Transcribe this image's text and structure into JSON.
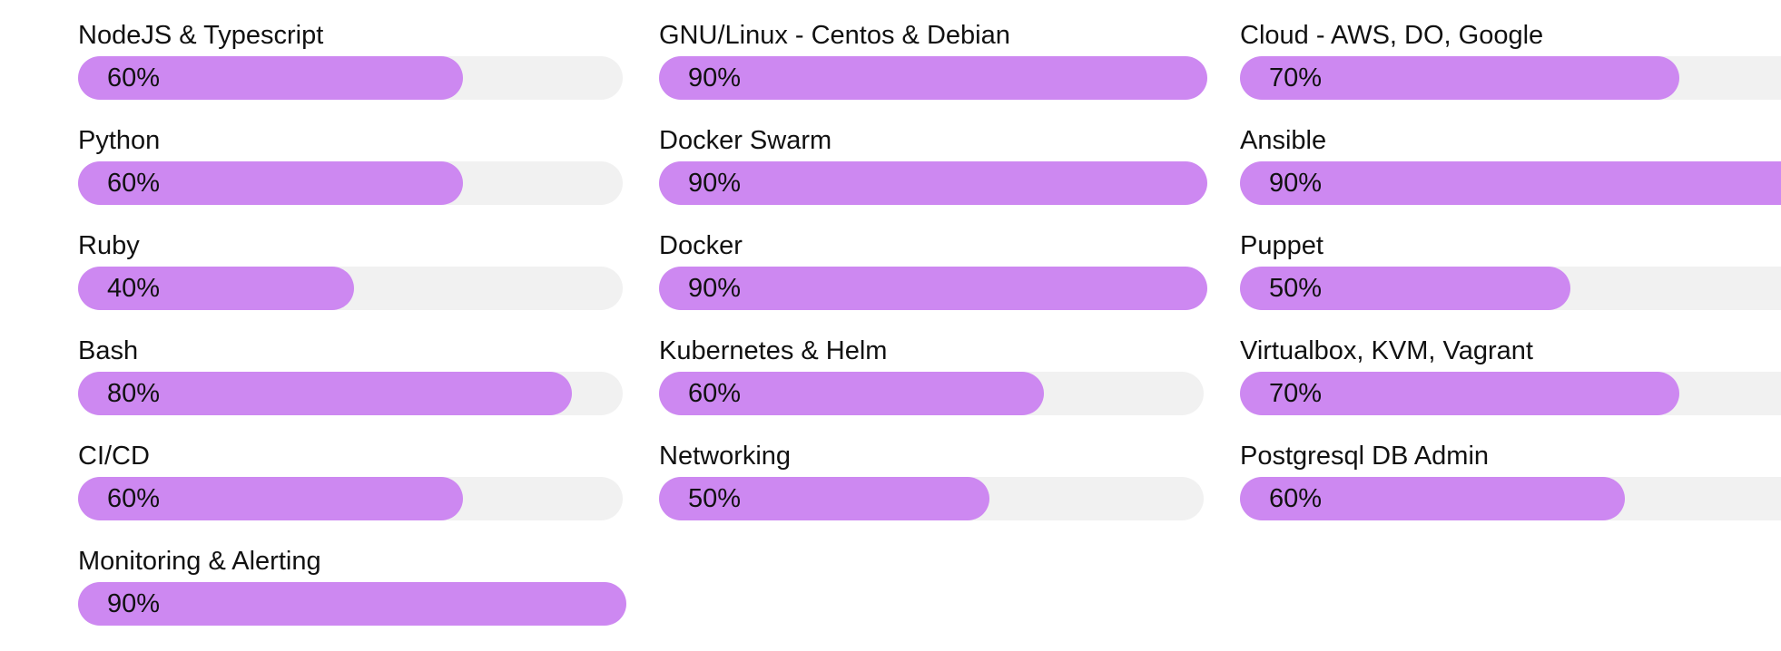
{
  "accent_color": "#cd88f1",
  "track_color": "#f1f1f1",
  "columns": [
    {
      "skills": [
        {
          "name": "NodeJS & Typescript",
          "level": 60,
          "label": "60%"
        },
        {
          "name": "Python",
          "level": 60,
          "label": "60%"
        },
        {
          "name": "Ruby",
          "level": 40,
          "label": "40%"
        },
        {
          "name": "Bash",
          "level": 80,
          "label": "80%"
        },
        {
          "name": "CI/CD",
          "level": 60,
          "label": "60%"
        },
        {
          "name": "Monitoring & Alerting",
          "level": 90,
          "label": "90%"
        }
      ]
    },
    {
      "skills": [
        {
          "name": "GNU/Linux - Centos & Debian",
          "level": 90,
          "label": "90%"
        },
        {
          "name": "Docker Swarm",
          "level": 90,
          "label": "90%"
        },
        {
          "name": "Docker",
          "level": 90,
          "label": "90%"
        },
        {
          "name": "Kubernetes & Helm",
          "level": 60,
          "label": "60%"
        },
        {
          "name": "Networking",
          "level": 50,
          "label": "50%"
        }
      ]
    },
    {
      "skills": [
        {
          "name": "Cloud - AWS, DO, Google",
          "level": 70,
          "label": "70%"
        },
        {
          "name": "Ansible",
          "level": 90,
          "label": "90%"
        },
        {
          "name": "Puppet",
          "level": 50,
          "label": "50%"
        },
        {
          "name": "Virtualbox, KVM, Vagrant",
          "level": 70,
          "label": "70%"
        },
        {
          "name": "Postgresql DB Admin",
          "level": 60,
          "label": "60%"
        }
      ]
    }
  ]
}
